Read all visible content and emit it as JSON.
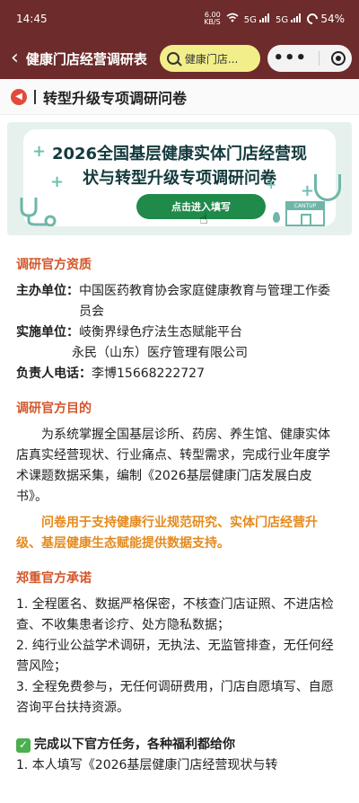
{
  "status_bar": {
    "time": "14:45",
    "net_speed_value": "6.00",
    "net_speed_unit": "KB/S",
    "signal_labels": [
      "5G",
      "5G"
    ],
    "battery": "54%"
  },
  "nav": {
    "title": "健康门店经营调研表",
    "search_text": "健康门店...",
    "more_label": "•••"
  },
  "page_header": {
    "title": "转型升级专项调研问卷"
  },
  "banner": {
    "title": "2026全国基层健康实体门店经营现状与转型升级专项调研问卷",
    "cta_label": "点击进入填写",
    "store_sign": "CANTUP"
  },
  "sections": {
    "qual": {
      "title": "调研官方资质",
      "host_key": "主办单位：",
      "host_val": "中国医药教育协会家庭健康教育与管理工作委员会",
      "impl_key": "实施单位：",
      "impl_val1": "岐衡界绿色疗法生态赋能平台",
      "impl_val2": "永民（山东）医疗管理有限公司",
      "phone_key": "负责人电话：",
      "phone_val": "李博15668222727"
    },
    "purpose": {
      "title": "调研官方目的",
      "para": "为系统掌握全国基层诊所、药房、养生馆、健康实体店真实经营现状、行业痛点、转型需求，完成行业年度学术课题数据采集，编制《2026基层健康门店发展白皮书》。",
      "highlight": "问卷用于支持健康行业规范研究、实体门店经营升级、基层健康生态赋能提供数据支持。"
    },
    "promise": {
      "title": "郑重官方承诺",
      "items": [
        "1. 全程匿名、数据严格保密，不核查门店证照、不进店检查、不收集患者诊疗、处方隐私数据；",
        "2. 纯行业公益学术调研，无执法、无监管排查，无任何经营风险；",
        "3. 全程免费参与，无任何调研费用，门店自愿填写、自愿咨询平台扶持资源。"
      ]
    },
    "tasks": {
      "title": "完成以下官方任务，各种福利都给你",
      "first_item": "1. 本人填写《2026基层健康门店经营现状与转"
    }
  }
}
